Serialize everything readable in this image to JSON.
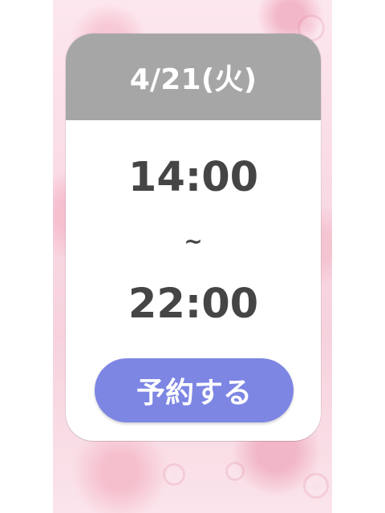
{
  "card": {
    "date": "4/21(火)",
    "start_time": "14:00",
    "separator": "~",
    "end_time": "22:00",
    "reserve_label": "予約する"
  },
  "colors": {
    "header_background": "#a6a6a6",
    "button_background": "#7d86e3",
    "time_text": "#454545"
  }
}
